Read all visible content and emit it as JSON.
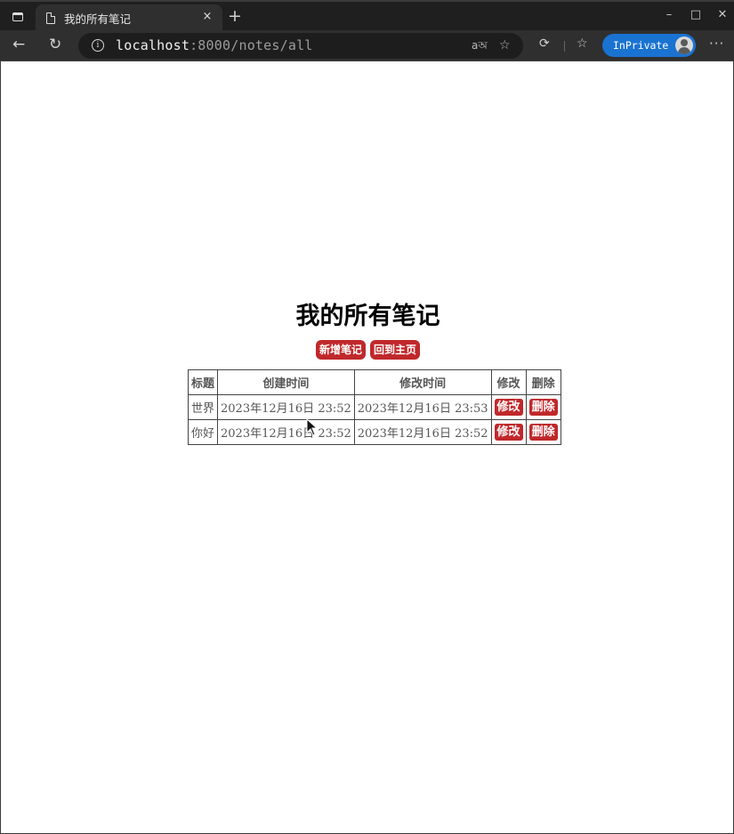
{
  "browser": {
    "tab_title": "我的所有笔记",
    "tab_close": "×",
    "new_tab": "+",
    "url_host": "localhost",
    "url_rest": ":8000/notes/all",
    "info_glyph": "i",
    "inprivate_label": "InPrivate",
    "more_glyph": "···",
    "icons": {
      "tab_actions": "tab-actions-icon",
      "page": "page-icon",
      "back": "back-arrow-icon",
      "refresh": "refresh-icon",
      "info": "info-icon",
      "read_aloud": "read-aloud-icon",
      "favorite_add": "add-favorite-icon",
      "extensions": "extensions-icon",
      "favorites": "favorites-icon",
      "profile": "profile-avatar-icon",
      "more": "more-options-icon"
    }
  },
  "page": {
    "title": "我的所有笔记",
    "buttons": {
      "new_note": "新增笔记",
      "home": "回到主页"
    },
    "table": {
      "headers": [
        "标题",
        "创建时间",
        "修改时间",
        "修改",
        "删除"
      ],
      "rows": [
        {
          "title": "世界",
          "created": "2023年12月16日 23:52",
          "modified": "2023年12月16日 23:53",
          "edit": "修改",
          "delete": "删除"
        },
        {
          "title": "你好",
          "created": "2023年12月16日 23:52",
          "modified": "2023年12月16日 23:52",
          "edit": "修改",
          "delete": "删除"
        }
      ]
    }
  },
  "colors": {
    "accent_button": "#c0282b",
    "inprivate_badge": "#1a73d1",
    "chrome_dark": "#1f1f1f"
  }
}
